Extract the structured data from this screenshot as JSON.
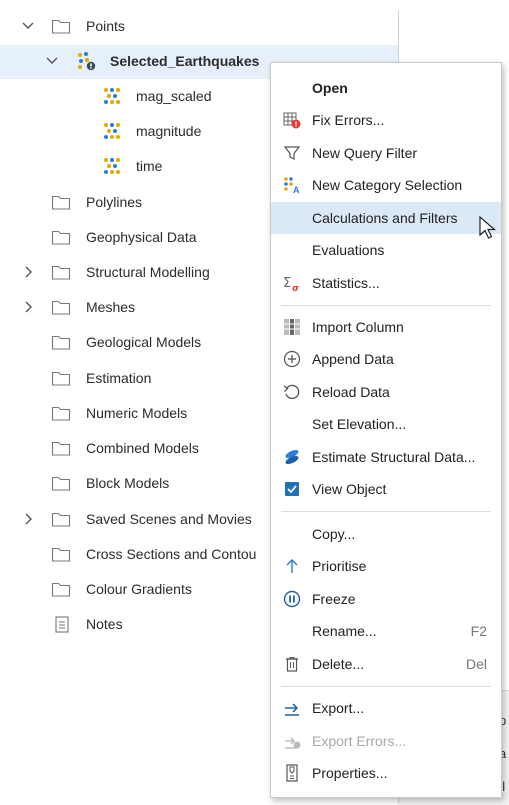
{
  "tree": {
    "items": [
      {
        "label": "Points",
        "chevron": "down",
        "icon": "folder"
      },
      {
        "label": "Selected_Earthquakes",
        "chevron": "down",
        "icon": "points-icon"
      },
      {
        "label": "mag_scaled",
        "icon": "points-icon"
      },
      {
        "label": "magnitude",
        "icon": "points-icon"
      },
      {
        "label": "time",
        "icon": "points-icon"
      },
      {
        "label": "Polylines",
        "icon": "folder"
      },
      {
        "label": "Geophysical Data",
        "icon": "folder"
      },
      {
        "label": "Structural Modelling",
        "chevron": "right",
        "icon": "folder"
      },
      {
        "label": "Meshes",
        "chevron": "right",
        "icon": "folder"
      },
      {
        "label": "Geological Models",
        "icon": "folder"
      },
      {
        "label": "Estimation",
        "icon": "folder"
      },
      {
        "label": "Numeric Models",
        "icon": "folder"
      },
      {
        "label": "Combined Models",
        "icon": "folder"
      },
      {
        "label": "Block Models",
        "icon": "folder"
      },
      {
        "label": "Saved Scenes and Movies",
        "chevron": "right",
        "icon": "folder"
      },
      {
        "label": "Cross Sections and Contou",
        "icon": "folder"
      },
      {
        "label": "Colour Gradients",
        "icon": "folder"
      },
      {
        "label": "Notes",
        "icon": "notes-icon"
      }
    ]
  },
  "menu": {
    "open": "Open",
    "fix_errors": "Fix Errors...",
    "new_query_filter": "New Query Filter",
    "new_category_selection": "New Category Selection",
    "calculations_and_filters": "Calculations and Filters",
    "evaluations": "Evaluations",
    "statistics": "Statistics...",
    "import_column": "Import Column",
    "append_data": "Append Data",
    "reload_data": "Reload Data",
    "set_elevation": "Set Elevation...",
    "estimate_structural_data": "Estimate Structural Data...",
    "view_object": "View Object",
    "copy": "Copy...",
    "prioritise": "Prioritise",
    "freeze": "Freeze",
    "rename": "Rename...",
    "rename_shortcut": "F2",
    "delete": "Delete...",
    "delete_shortcut": "Del",
    "export": "Export...",
    "export_errors": "Export Errors...",
    "properties": "Properties..."
  },
  "side_fragments": [
    "p",
    "a",
    "el"
  ],
  "colors": {
    "accent": "#1a73c8",
    "selection": "#e6f0fa",
    "menu_hover": "#dbe9f7",
    "points_yellow": "#e0a800",
    "points_blue": "#2a7fd4"
  }
}
